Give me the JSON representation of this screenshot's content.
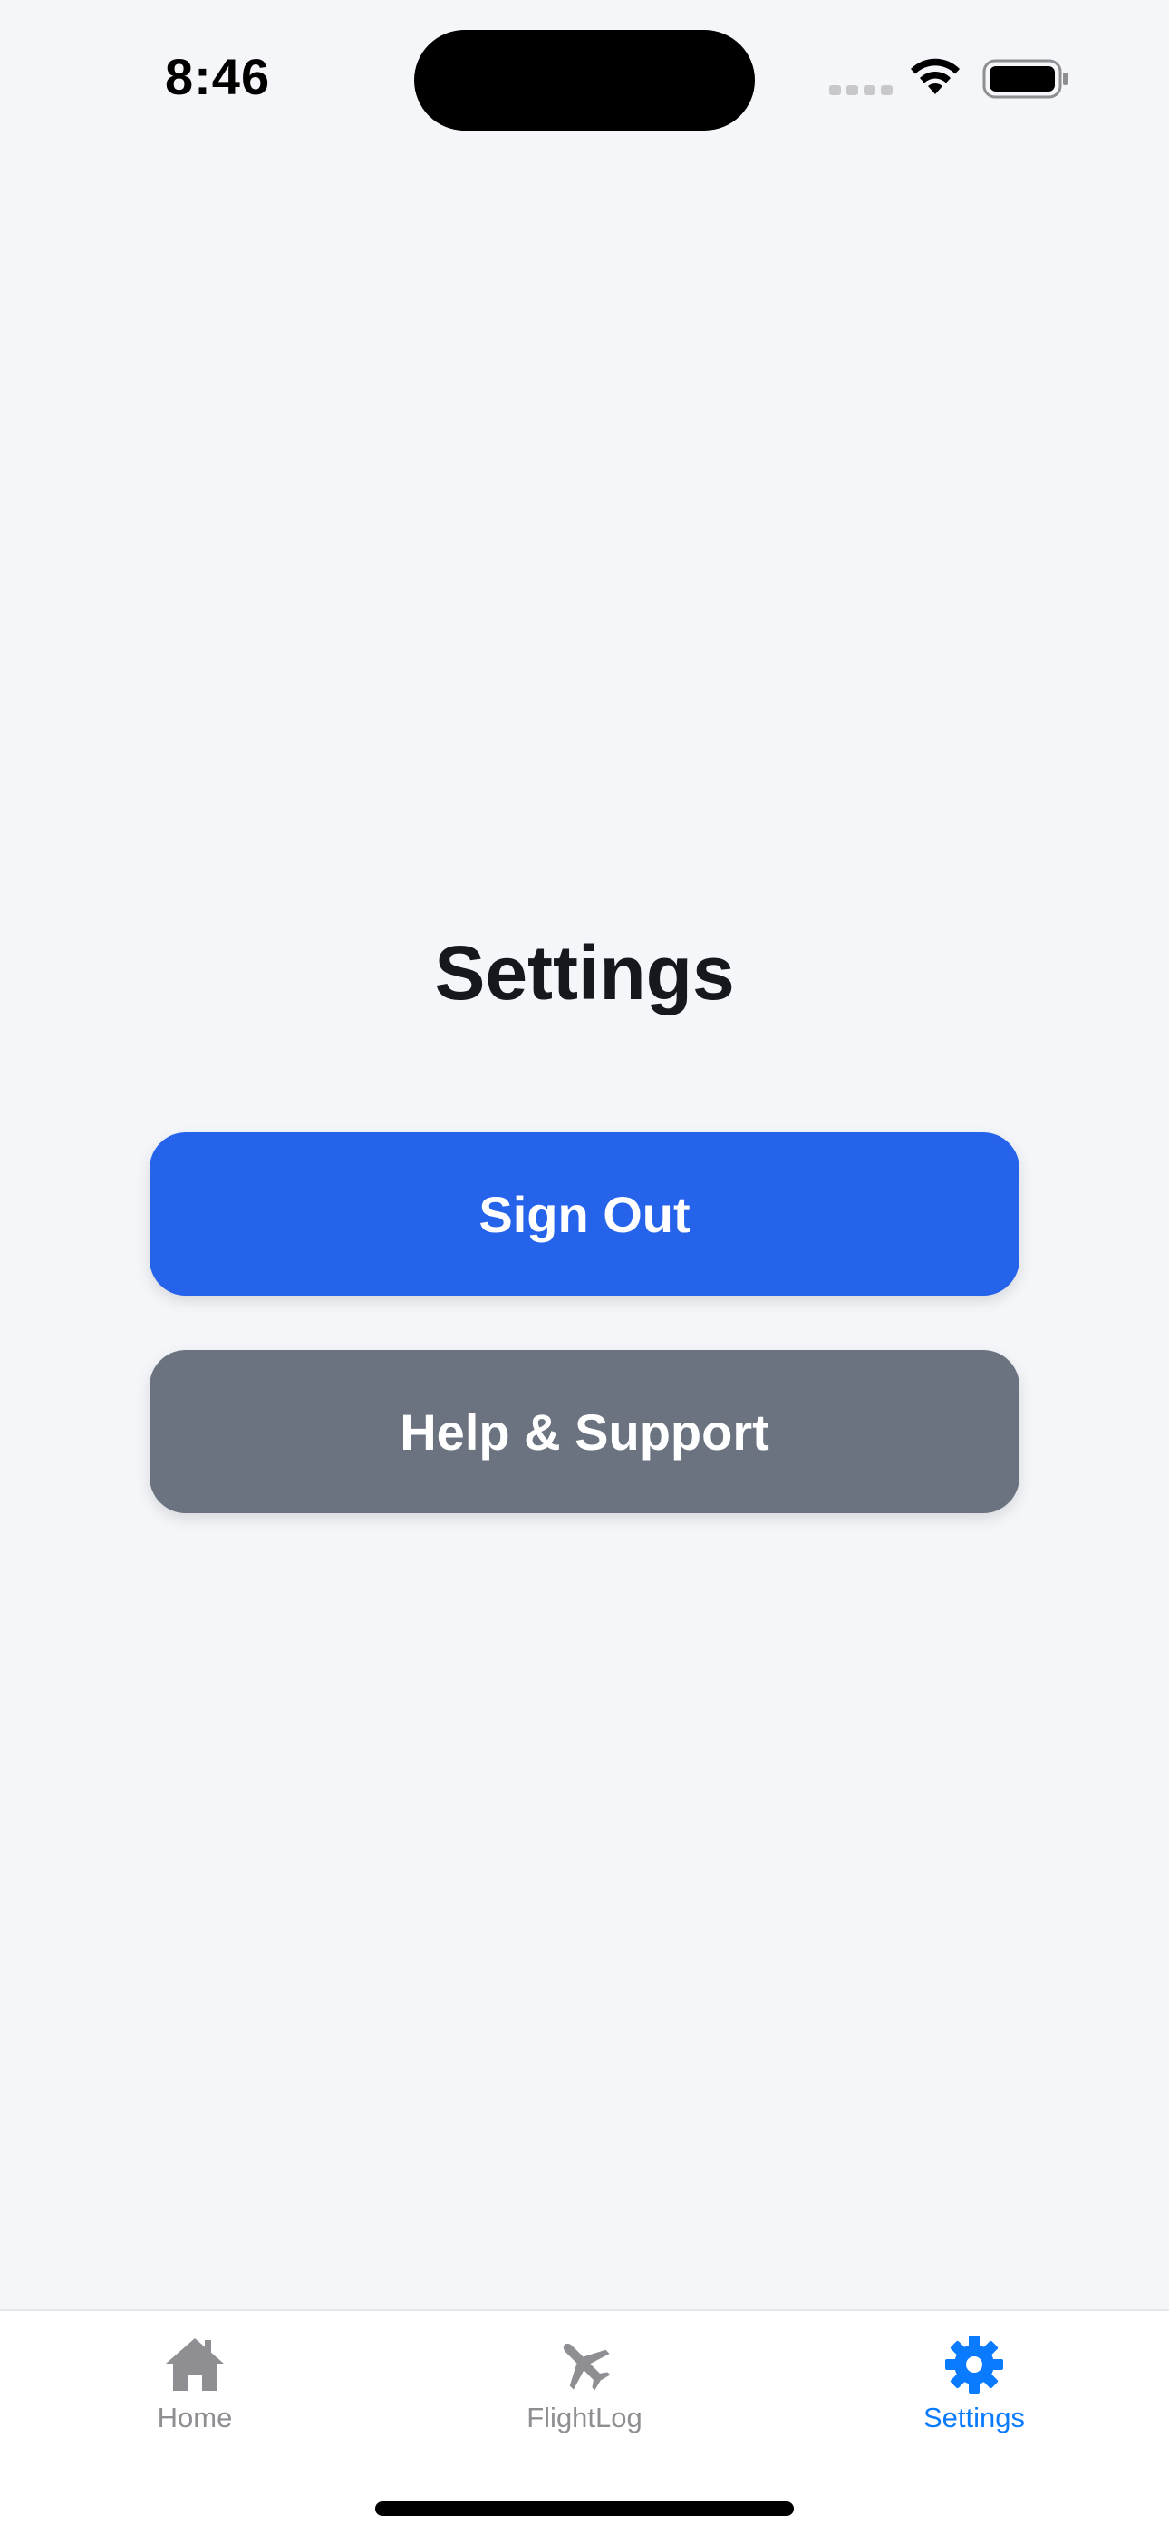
{
  "status_bar": {
    "time": "8:46"
  },
  "main": {
    "title": "Settings",
    "sign_out_label": "Sign Out",
    "help_support_label": "Help & Support"
  },
  "tab_bar": {
    "items": [
      {
        "label": "Home",
        "icon": "home-icon",
        "active": false
      },
      {
        "label": "FlightLog",
        "icon": "airplane-icon",
        "active": false
      },
      {
        "label": "Settings",
        "icon": "gear-icon",
        "active": true
      }
    ]
  },
  "colors": {
    "primary_button": "#2563eb",
    "secondary_button": "#6b7280",
    "active_tab": "#0a7aff",
    "inactive_tab": "#8e8e93",
    "background": "#f4f6fa"
  }
}
